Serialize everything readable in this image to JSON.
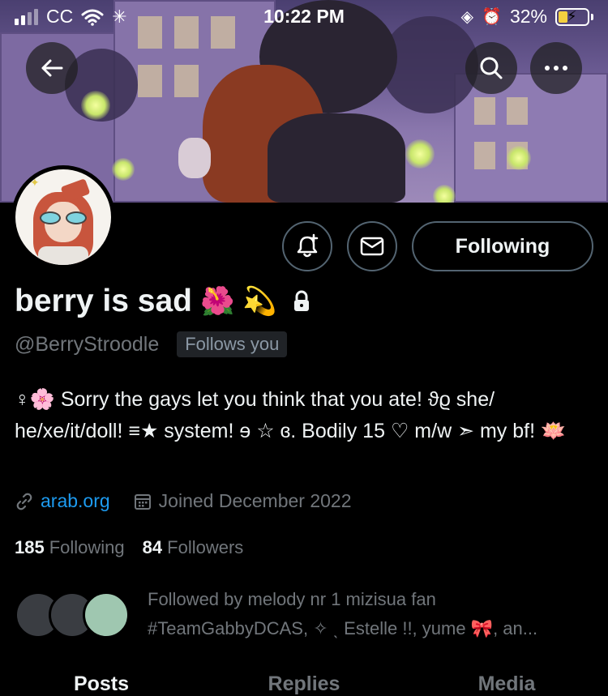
{
  "status_bar": {
    "carrier": "CC",
    "time": "10:22 PM",
    "battery_percent": "32%",
    "battery_level": 0.32
  },
  "header": {
    "back_icon": "arrow-left-icon",
    "search_icon": "search-icon",
    "more_icon": "more-horizontal-icon"
  },
  "profile": {
    "display_name": "berry is sad",
    "name_emojis": [
      "🌺",
      "💫"
    ],
    "handle": "@BerryStroodle",
    "follows_you": "Follows you",
    "following_button": "Following",
    "bio": "♀🌸 Sorry the gays let you think that you ate! ϑϱ she/ he/xe/it/doll! ≡★ system! ɘ ☆ ɞ. Bodily 15 ♡ m/w ➣ my bf! 🪷",
    "link": "arab.org",
    "joined": "Joined December 2022",
    "following_count": "185",
    "following_label": "Following",
    "followers_count": "84",
    "followers_label": "Followers",
    "followed_by": "Followed by melody nr 1 mizisua fan #TeamGabbyDCAS, ✧ ˎ Estelle !!, yume 🎀, an..."
  },
  "tabs": [
    "Posts",
    "Replies",
    "Media"
  ],
  "colors": {
    "accent_link": "#1d9bf0",
    "muted_text": "#71767b",
    "border": "#536471",
    "battery_fill": "#f4d03f"
  }
}
